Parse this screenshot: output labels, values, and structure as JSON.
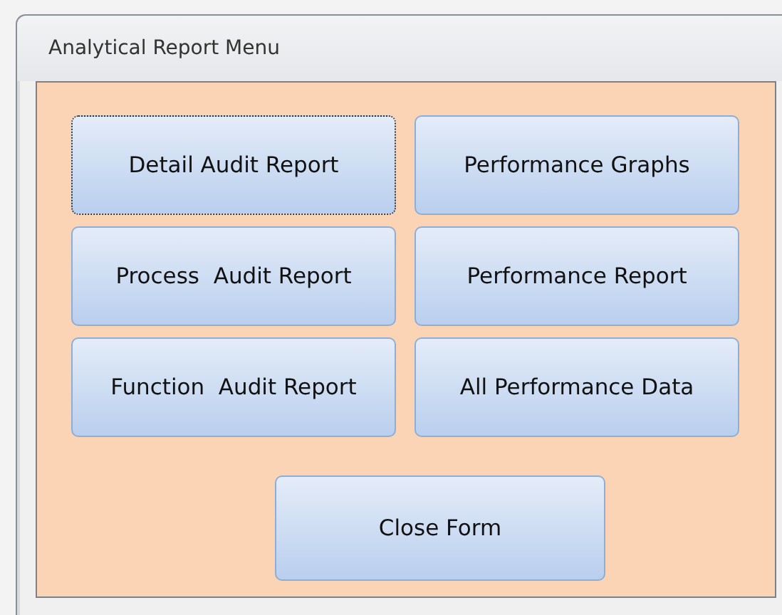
{
  "window": {
    "title": "Analytical Report Menu"
  },
  "buttons": [
    {
      "label": "Detail Audit Report",
      "focused": true
    },
    {
      "label": "Performance Graphs",
      "focused": false
    },
    {
      "label": "Process  Audit Report",
      "focused": false
    },
    {
      "label": "Performance Report",
      "focused": false
    },
    {
      "label": "Function  Audit Report",
      "focused": false
    },
    {
      "label": "All Performance Data",
      "focused": false
    }
  ],
  "close_button": {
    "label": "Close Form",
    "focused": false
  }
}
